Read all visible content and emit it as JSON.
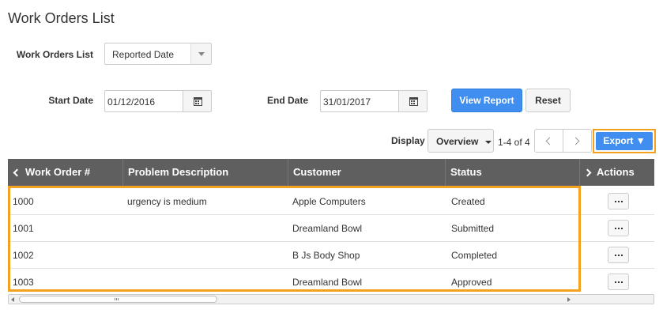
{
  "page": {
    "title": "Work Orders List"
  },
  "filters": {
    "work_orders_list_label": "Work Orders List",
    "work_orders_list_value": "Reported Date",
    "start_date_label": "Start Date",
    "start_date_value": "01/12/2016",
    "end_date_label": "End Date",
    "end_date_value": "31/01/2017",
    "view_report_label": "View Report",
    "reset_label": "Reset"
  },
  "toolbar": {
    "display_label": "Display",
    "display_value": "Overview",
    "range_text": "1-4 of 4",
    "export_label": "Export ▼"
  },
  "table": {
    "headers": {
      "work_order": "Work Order #",
      "problem": "Problem Description",
      "customer": "Customer",
      "status": "Status",
      "actions": "Actions"
    },
    "rows": [
      {
        "work_order": "1000",
        "problem": "urgency is medium",
        "customer": "Apple Computers",
        "status": "Created"
      },
      {
        "work_order": "1001",
        "problem": "",
        "customer": "Dreamland Bowl",
        "status": "Submitted"
      },
      {
        "work_order": "1002",
        "problem": "",
        "customer": "B Js Body Shop",
        "status": "Completed"
      },
      {
        "work_order": "1003",
        "problem": "",
        "customer": "Dreamland Bowl",
        "status": "Approved"
      }
    ]
  },
  "colors": {
    "accent": "#3f8ef0",
    "highlight": "#f2a21e",
    "header_bg": "#5f5f5f"
  }
}
